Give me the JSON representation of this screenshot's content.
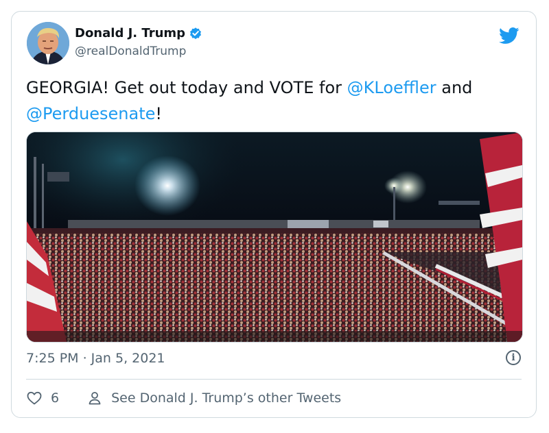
{
  "tweet": {
    "author_name": "Donald J. Trump",
    "handle": "@realDonaldTrump",
    "verified": true,
    "text_prefix": "GEORGIA! Get out today and VOTE for ",
    "mention_1": "@KLoeffler",
    "text_middle": " and ",
    "mention_2": "@Perduesenate",
    "text_suffix": "!",
    "timestamp": "7:25 PM · Jan 5, 2021",
    "like_count": "6",
    "other_tweets_label": "See Donald J. Trump’s other Tweets"
  },
  "icons": {
    "brand": "twitter-bird-icon",
    "verified": "verified-badge-icon",
    "info": "info-icon",
    "like": "heart-icon",
    "profile": "person-icon"
  },
  "colors": {
    "accent": "#1d9bf0",
    "text": "#0f1419",
    "muted": "#536471",
    "border": "#cfd9de"
  }
}
